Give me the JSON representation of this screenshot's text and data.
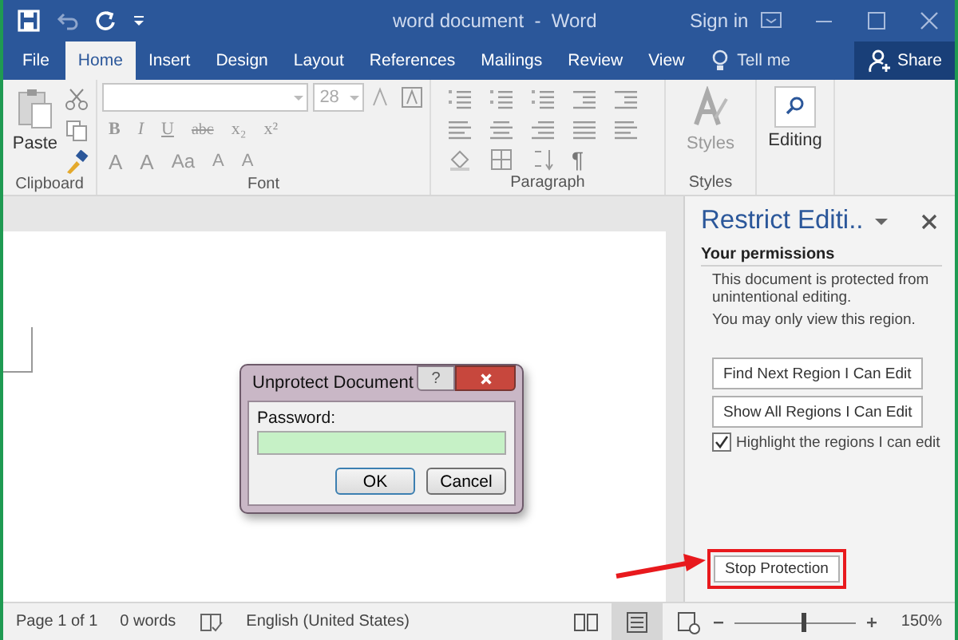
{
  "window": {
    "title": "word document  -  Word",
    "sign_in": "Sign in"
  },
  "tabs": [
    {
      "label": "File",
      "selected": false
    },
    {
      "label": "Home",
      "selected": true
    },
    {
      "label": "Insert",
      "selected": false
    },
    {
      "label": "Design",
      "selected": false
    },
    {
      "label": "Layout",
      "selected": false
    },
    {
      "label": "References",
      "selected": false
    },
    {
      "label": "Mailings",
      "selected": false
    },
    {
      "label": "Review",
      "selected": false
    },
    {
      "label": "View",
      "selected": false
    }
  ],
  "tell_me": "Tell me",
  "share": "Share",
  "ribbon": {
    "clipboard": {
      "paste": "Paste",
      "label": "Clipboard"
    },
    "font": {
      "size": "28",
      "row1": [
        "B",
        "I",
        "U",
        "abc",
        "x₂",
        "x²"
      ],
      "row2": [
        "A",
        "A",
        "Aa",
        "A",
        "A"
      ],
      "label": "Font"
    },
    "paragraph": {
      "mark": "¶",
      "label": "Paragraph"
    },
    "styles": {
      "button": "Styles",
      "label": "Styles"
    },
    "editing": {
      "button": "Editing"
    }
  },
  "dialog": {
    "title": "Unprotect Document",
    "help": "?",
    "field_label": "Password:",
    "ok": "OK",
    "cancel": "Cancel"
  },
  "pane": {
    "title": "Restrict Editi..",
    "heading": "Your permissions",
    "text": "This document is protected from unintentional editing.",
    "note": "You may only view this region.",
    "find_next": "Find Next Region I Can Edit",
    "show_all": "Show All Regions I Can Edit",
    "highlight": {
      "label": "Highlight the regions I can edit",
      "checked": true
    },
    "stop": "Stop Protection"
  },
  "status_bar": {
    "page": "Page 1 of 1",
    "words": "0 words",
    "language": "English (United States)",
    "views": [
      {
        "kind": "read",
        "selected": false
      },
      {
        "kind": "print",
        "selected": true
      },
      {
        "kind": "web",
        "selected": false
      }
    ],
    "zoom": {
      "level": 0.56,
      "reading": "150%"
    }
  }
}
